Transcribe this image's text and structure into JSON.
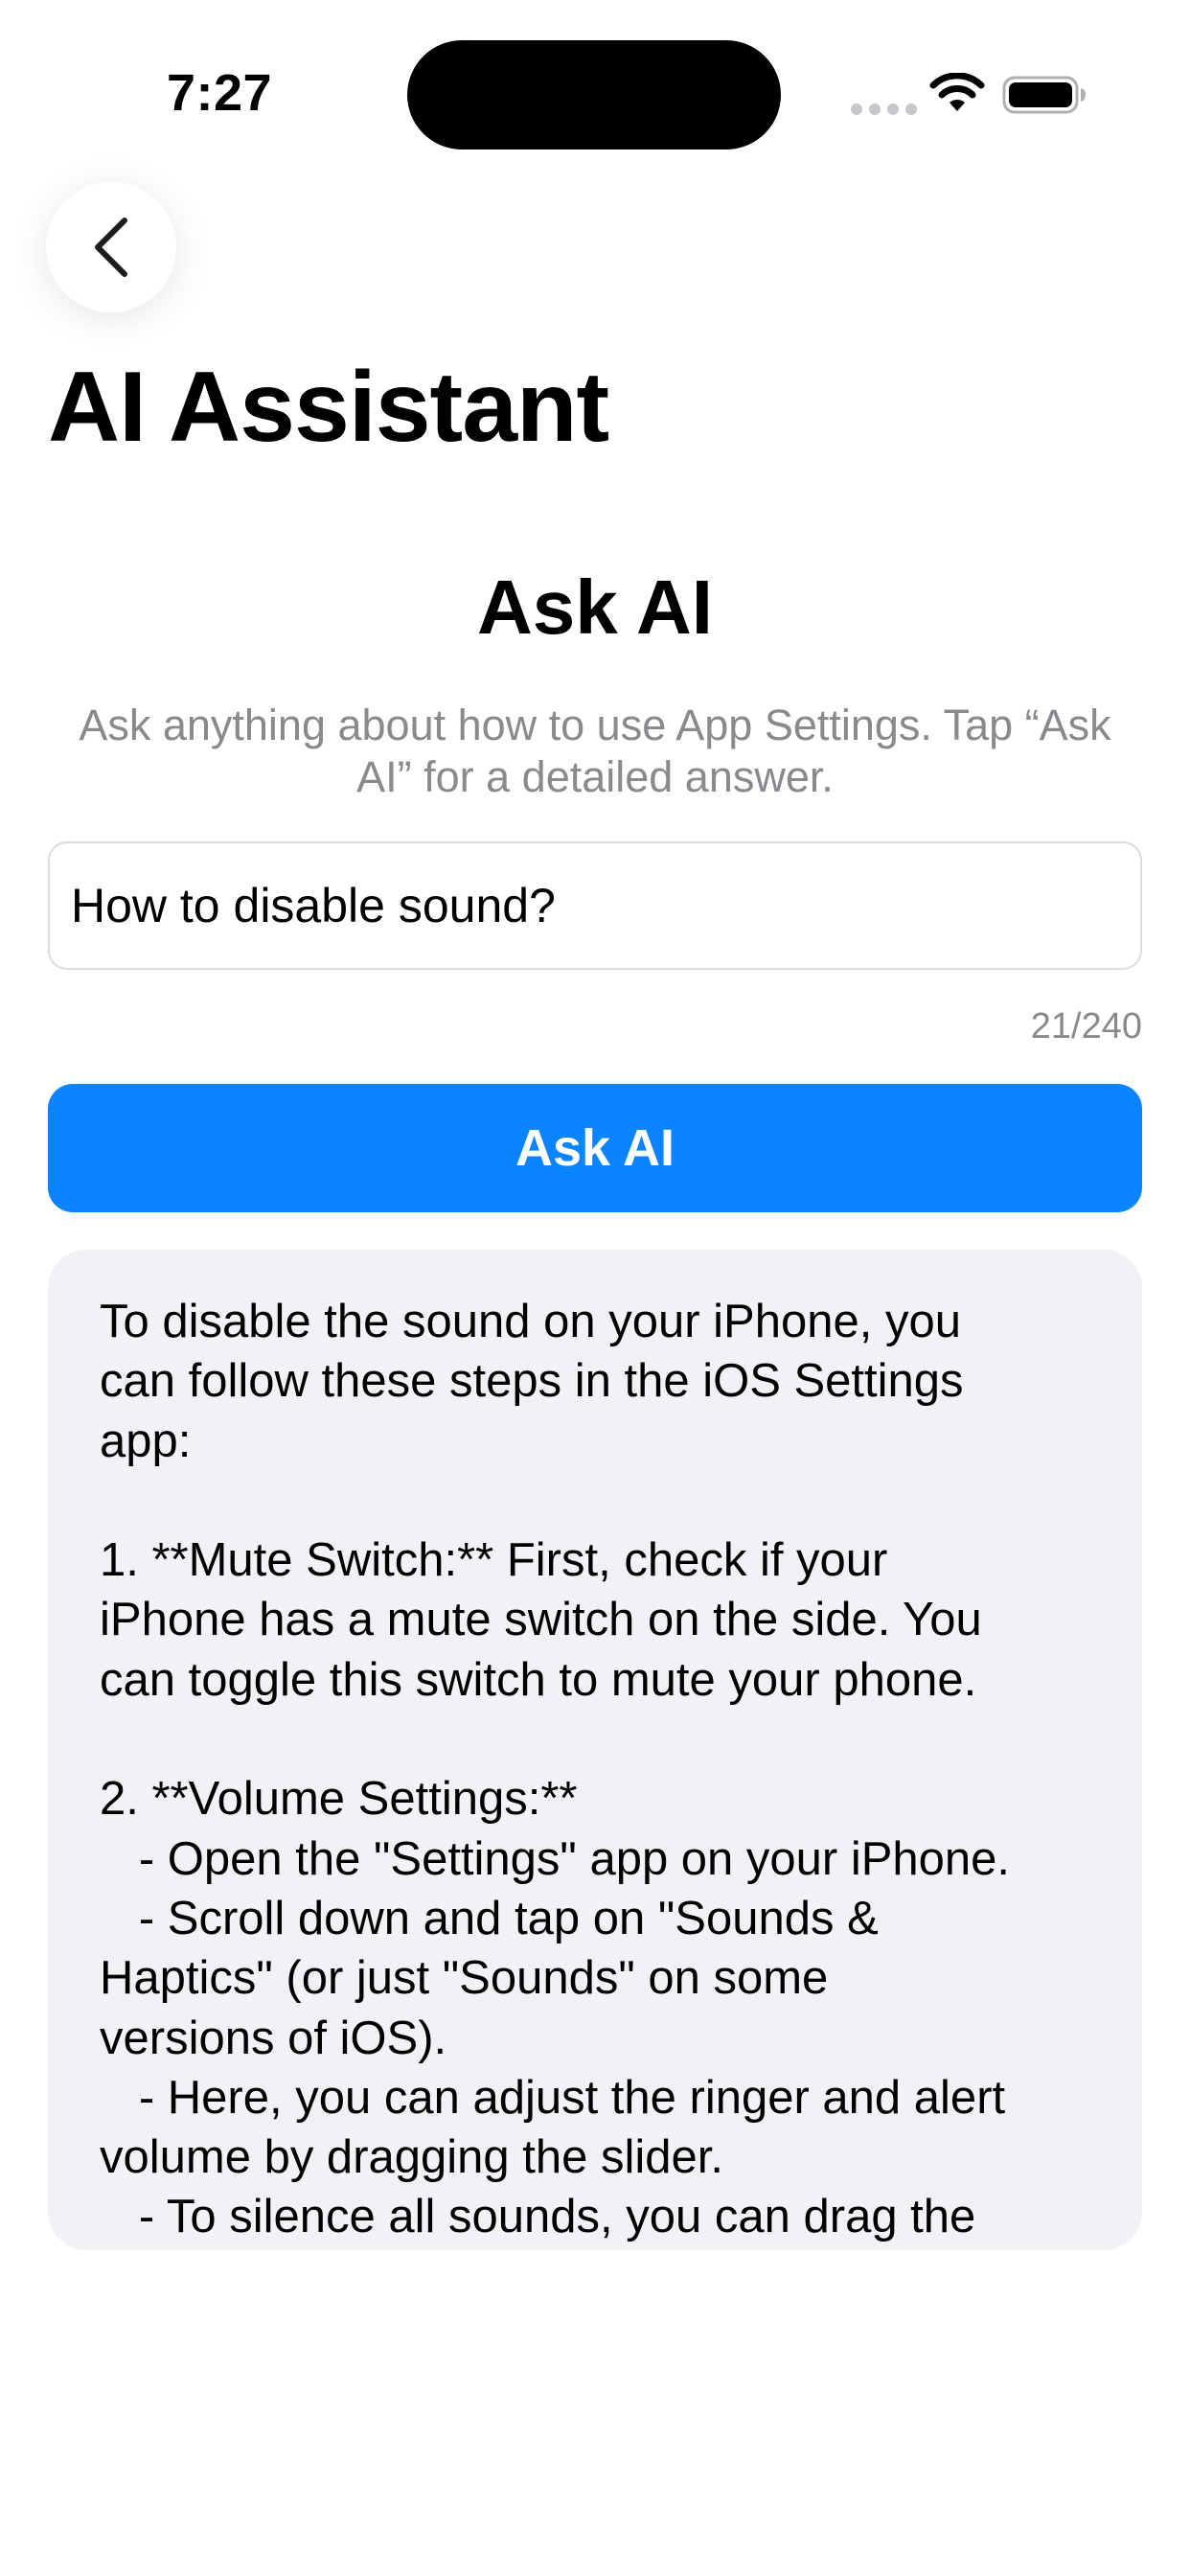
{
  "status_bar": {
    "time": "7:27",
    "icons": [
      "signal-dots-icon",
      "wifi-icon",
      "battery-icon"
    ]
  },
  "nav": {
    "back_icon": "chevron-left-icon"
  },
  "page_title": "AI Assistant",
  "ask_section": {
    "title": "Ask AI",
    "subtitle": "Ask anything about how to use App Settings. Tap “Ask AI” for a detailed answer.",
    "input_value": "How to disable sound?",
    "char_count": "21/240",
    "button_label": "Ask AI"
  },
  "answer": {
    "text": "To disable the sound on your iPhone, you\ncan follow these steps in the iOS Settings\napp:\n\n1. **Mute Switch:** First, check if your\niPhone has a mute switch on the side. You\ncan toggle this switch to mute your phone.\n\n2. **Volume Settings:**\n   - Open the \"Settings\" app on your iPhone.\n   - Scroll down and tap on \"Sounds &\nHaptics\" (or just \"Sounds\" on some\nversions of iOS).\n   - Here, you can adjust the ringer and alert\nvolume by dragging the slider.\n   - To silence all sounds, you can drag the"
  },
  "colors": {
    "accent": "#0a84ff",
    "card_background": "#f2f2f6",
    "secondary_text": "#8a8a8e"
  }
}
